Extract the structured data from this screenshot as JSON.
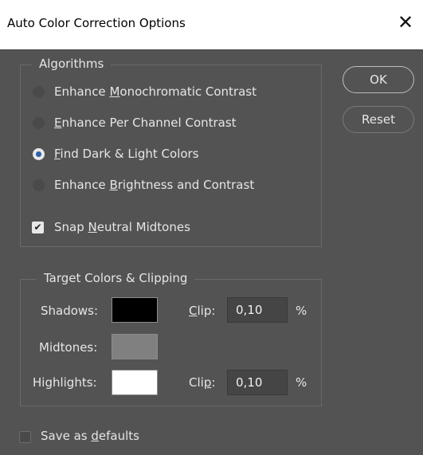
{
  "window": {
    "title": "Auto Color Correction Options",
    "close_glyph": "✕"
  },
  "algorithms": {
    "legend": "Algorithms",
    "options": [
      {
        "pre": "Enhance ",
        "ul": "M",
        "post": "onochromatic Contrast",
        "selected": false
      },
      {
        "pre": "",
        "ul": "E",
        "post": "nhance Per Channel Contrast",
        "selected": false
      },
      {
        "pre": "",
        "ul": "F",
        "post": "ind Dark & Light Colors",
        "selected": true
      },
      {
        "pre": "Enhance ",
        "ul": "B",
        "post": "rightness and Contrast",
        "selected": false
      }
    ],
    "snap": {
      "pre": "Snap ",
      "ul": "N",
      "post": "eutral Midtones",
      "checked": true,
      "check_glyph": "✔"
    }
  },
  "buttons": {
    "ok": "OK",
    "reset": "Reset"
  },
  "target": {
    "legend": "Target Colors & Clipping",
    "shadows": {
      "label": "Shadows:",
      "color": "#000000",
      "clip_pre": "",
      "clip_ul": "C",
      "clip_post": "lip:",
      "clip_value": "0,10",
      "unit": "%"
    },
    "midtones": {
      "label": "Midtones:",
      "color": "#808080"
    },
    "highlights": {
      "label": "Highlights:",
      "color": "#ffffff",
      "clip_pre": "Cli",
      "clip_ul": "p",
      "clip_post": ":",
      "clip_value": "0,10",
      "unit": "%"
    }
  },
  "defaults": {
    "pre": "Save as ",
    "ul": "d",
    "post": "efaults",
    "checked": false
  },
  "colors": {
    "background": "#535353",
    "radio_selected": "#2b5faa"
  }
}
